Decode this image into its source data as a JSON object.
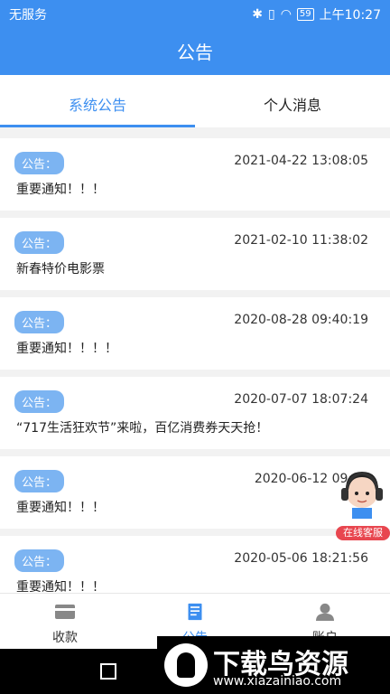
{
  "status_bar": {
    "carrier": "无服务",
    "battery": "59",
    "time": "上午10:27"
  },
  "header": {
    "title": "公告"
  },
  "tabs": [
    {
      "label": "系统公告",
      "active": true
    },
    {
      "label": "个人消息",
      "active": false
    }
  ],
  "notices": [
    {
      "badge": "公告：",
      "time": "2021-04-22 13:08:05",
      "content": "重要通知！！！"
    },
    {
      "badge": "公告：",
      "time": "2021-02-10 11:38:02",
      "content": "新春特价电影票"
    },
    {
      "badge": "公告：",
      "time": "2020-08-28 09:40:19",
      "content": "重要通知！！！！"
    },
    {
      "badge": "公告：",
      "time": "2020-07-07 18:07:24",
      "content": "“717生活狂欢节”来啦，百亿消费券天天抢！"
    },
    {
      "badge": "公告：",
      "time": "2020-06-12 09:34",
      "content": "重要通知！！！"
    },
    {
      "badge": "公告：",
      "time": "2020-05-06 18:21:56",
      "content": "重要通知！！！"
    }
  ],
  "customer_service": {
    "label": "在线客服"
  },
  "bottom_nav": [
    {
      "label": "收款",
      "icon": "card-icon",
      "active": false
    },
    {
      "label": "公告",
      "icon": "notice-icon",
      "active": true
    },
    {
      "label": "账户",
      "icon": "user-icon",
      "active": false
    }
  ],
  "watermark": {
    "title": "下载鸟资源",
    "url": "www.xiazainiao.com"
  },
  "colors": {
    "primary": "#3d8ff0",
    "badge": "#7cb4f2",
    "service_label": "#e8464f"
  }
}
